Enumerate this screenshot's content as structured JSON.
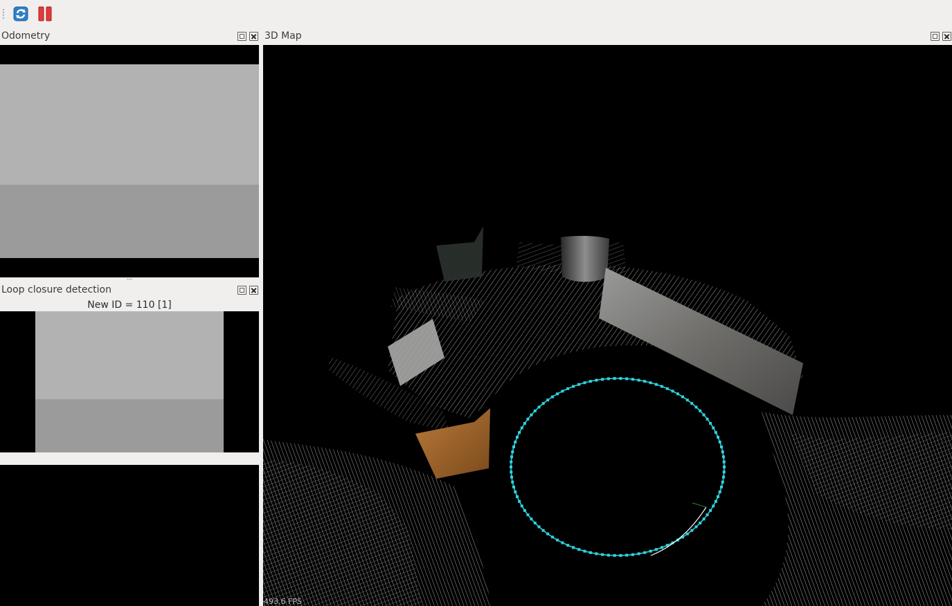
{
  "toolbar": {
    "buttons": [
      {
        "name": "refresh-button",
        "icon": "refresh-icon"
      },
      {
        "name": "pause-button",
        "icon": "pause-icon"
      }
    ]
  },
  "docks": {
    "odometry": {
      "title": "Odometry"
    },
    "loop_closure": {
      "title": "Loop closure detection",
      "status": "New ID = 110 [1]"
    },
    "map3d": {
      "title": "3D Map",
      "fps": "493.6 FPS"
    }
  },
  "colors": {
    "window_bg": "#f0efed",
    "view_bg": "#000000",
    "trajectory": "#2fd4df",
    "image_upper": "#b2b2b2",
    "image_lower": "#9b9b9b"
  }
}
